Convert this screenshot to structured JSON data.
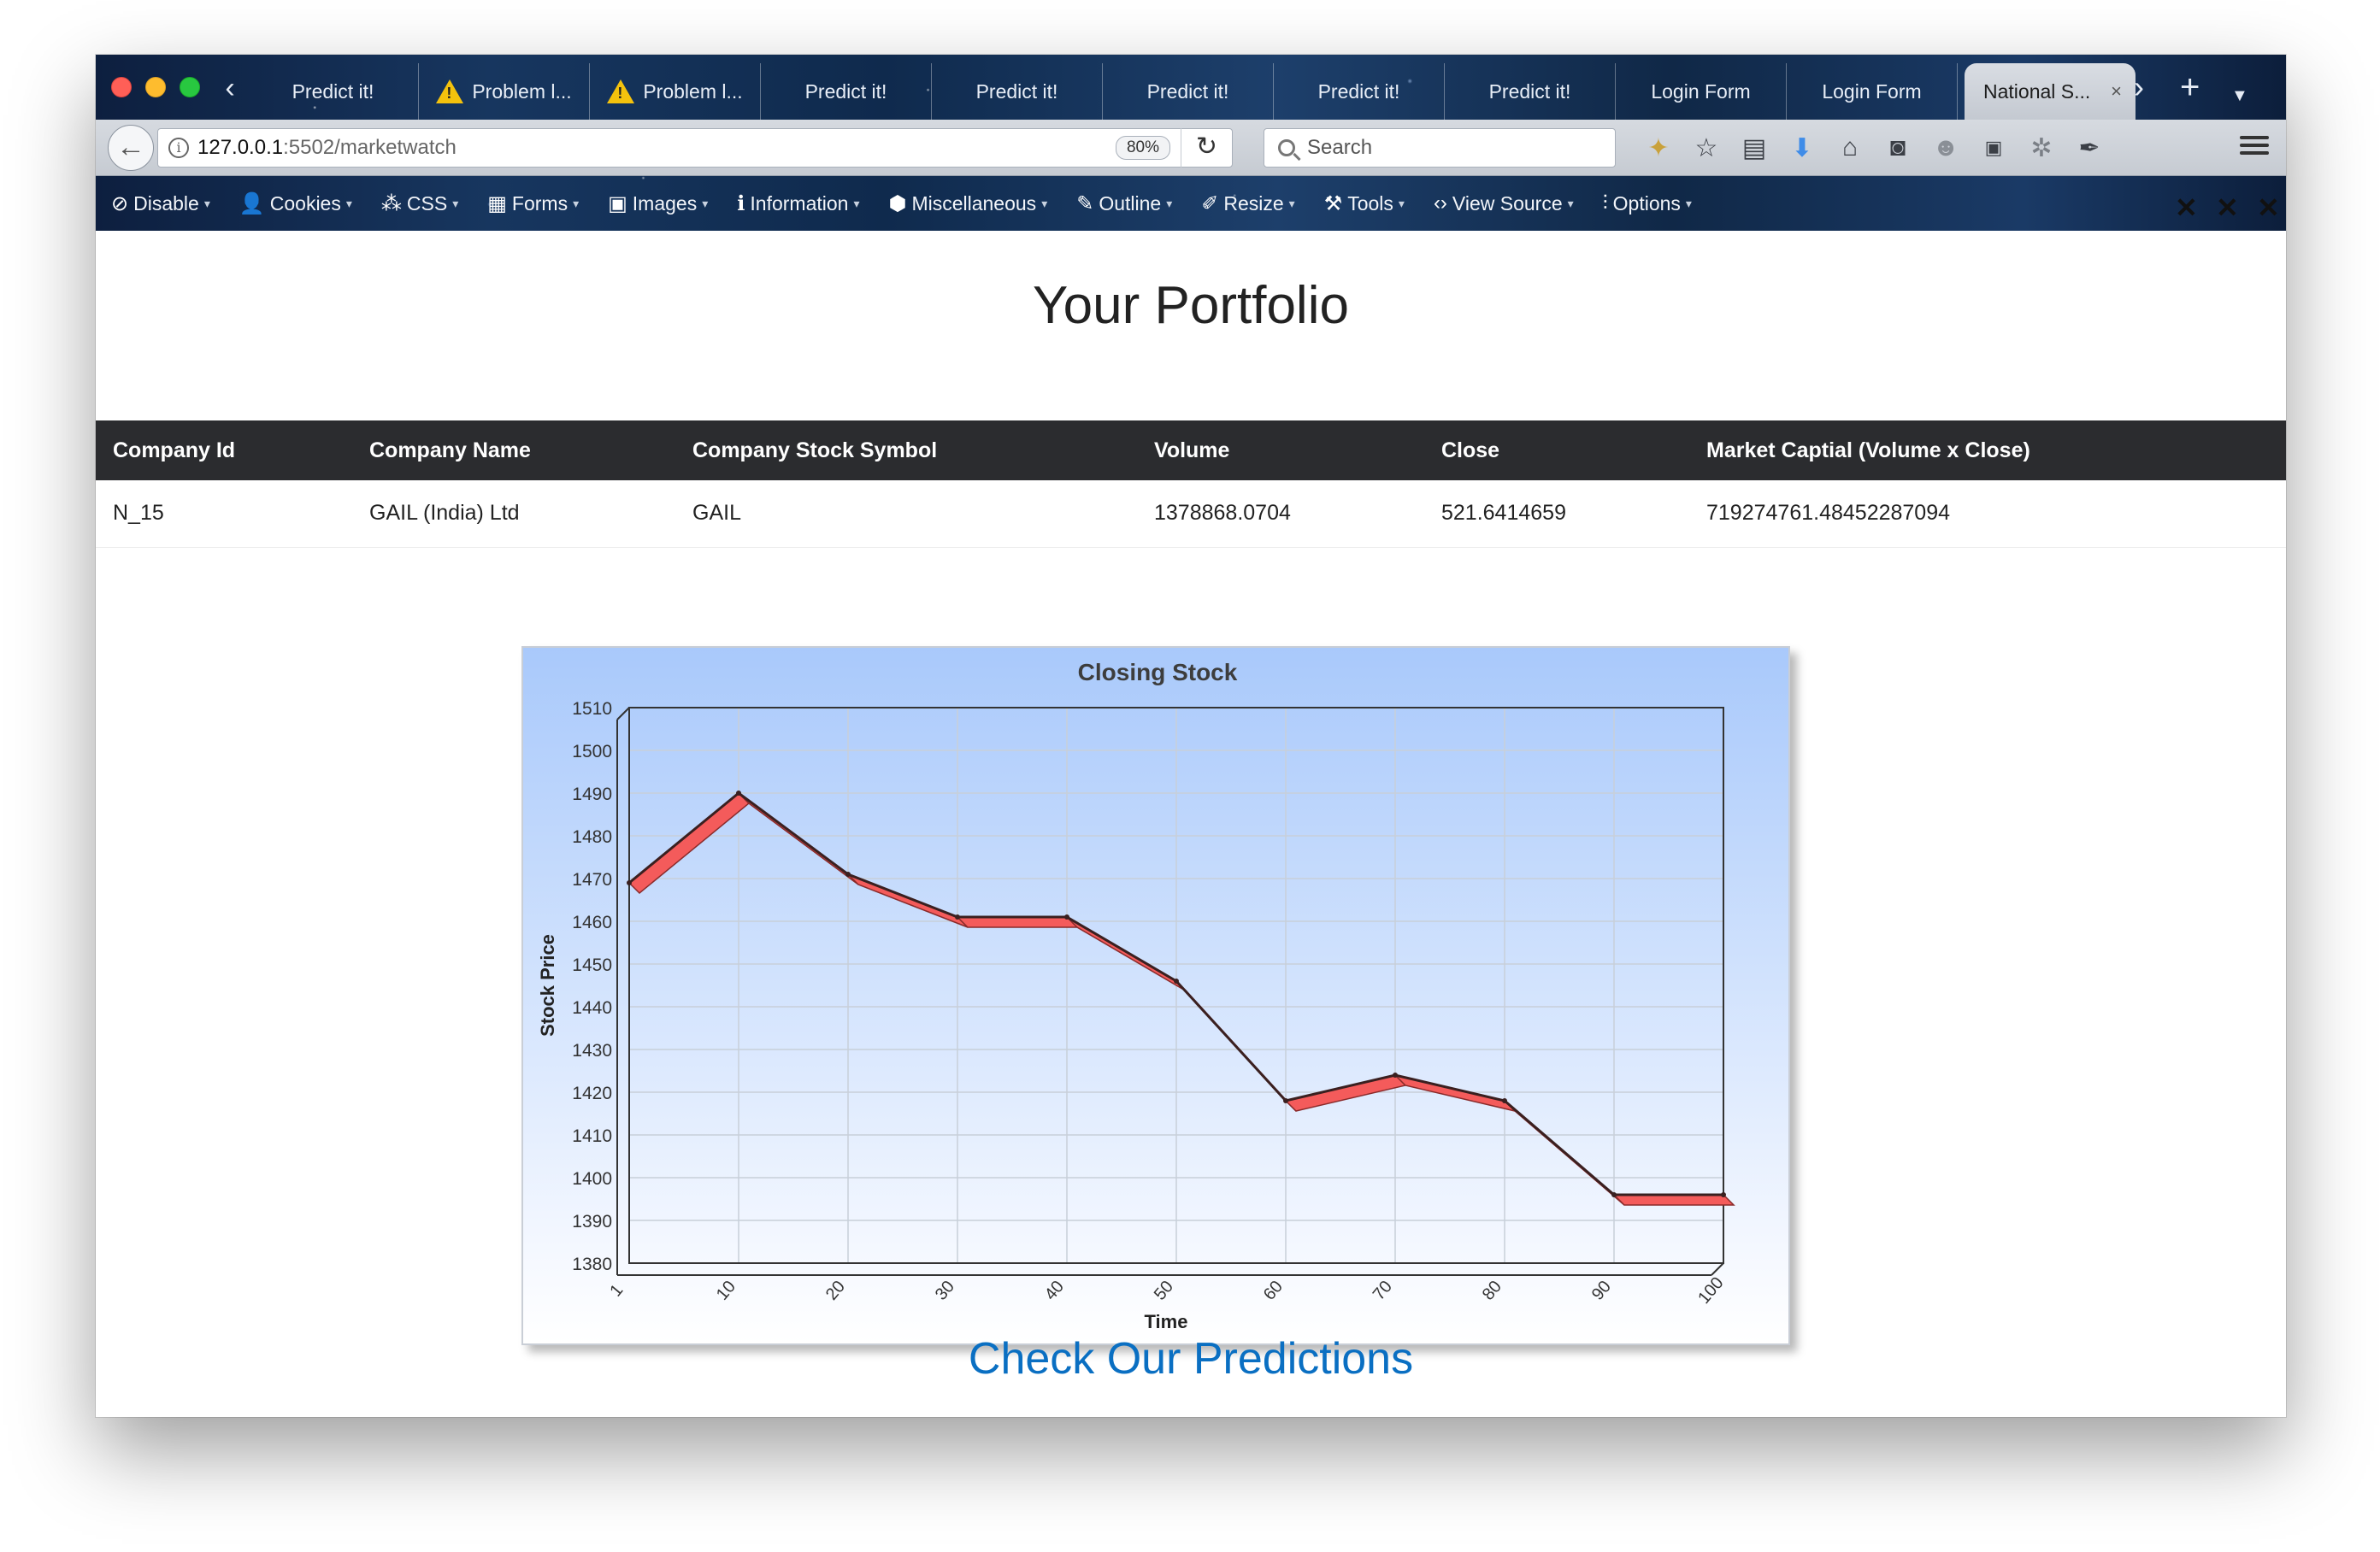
{
  "browser": {
    "tabs": [
      {
        "label": "Predict it!",
        "warning": false
      },
      {
        "label": "Problem l...",
        "warning": true
      },
      {
        "label": "Problem l...",
        "warning": true
      },
      {
        "label": "Predict it!",
        "warning": false
      },
      {
        "label": "Predict it!",
        "warning": false
      },
      {
        "label": "Predict it!",
        "warning": false
      },
      {
        "label": "Predict it!",
        "warning": false
      },
      {
        "label": "Predict it!",
        "warning": false
      },
      {
        "label": "Login Form",
        "warning": false
      },
      {
        "label": "Login Form",
        "warning": false
      }
    ],
    "active_tab": {
      "label": "National S...",
      "close": "×"
    },
    "new_tab": "+",
    "url_host": "127.0.0.1",
    "url_path": ":5502/marketwatch",
    "zoom": "80%",
    "search_placeholder": "Search"
  },
  "devbar": {
    "items": [
      {
        "label": "Disable",
        "icon": "⊘"
      },
      {
        "label": "Cookies",
        "icon": "👤"
      },
      {
        "label": "CSS",
        "icon": "⁂"
      },
      {
        "label": "Forms",
        "icon": "▦"
      },
      {
        "label": "Images",
        "icon": "▣"
      },
      {
        "label": "Information",
        "icon": "ℹ"
      },
      {
        "label": "Miscellaneous",
        "icon": "⬢"
      },
      {
        "label": "Outline",
        "icon": "✎"
      },
      {
        "label": "Resize",
        "icon": "✐"
      },
      {
        "label": "Tools",
        "icon": "⚒"
      },
      {
        "label": "View Source",
        "icon": "‹›"
      },
      {
        "label": "Options",
        "icon": "⫶"
      }
    ]
  },
  "page": {
    "title": "Your Portfolio",
    "table": {
      "headers": [
        "Company Id",
        "Company Name",
        "Company Stock Symbol",
        "Volume",
        "Close",
        "Market Captial (Volume x Close)"
      ],
      "rows": [
        [
          "N_15",
          "GAIL (India) Ltd",
          "GAIL",
          "1378868.0704",
          "521.6414659",
          "719274761.48452287094"
        ]
      ]
    },
    "link": "Check Our Predictions"
  },
  "chart_data": {
    "type": "line",
    "title": "Closing Stock",
    "xlabel": "Time",
    "ylabel": "Stock Price",
    "categories": [
      "1",
      "10",
      "20",
      "30",
      "40",
      "50",
      "60",
      "70",
      "80",
      "90",
      "100"
    ],
    "values": [
      1469,
      1490,
      1471,
      1461,
      1461,
      1446,
      1418,
      1424,
      1418,
      1396,
      1396
    ],
    "ylim": [
      1380,
      1510
    ],
    "yticks": [
      1510,
      1500,
      1490,
      1480,
      1470,
      1460,
      1450,
      1440,
      1430,
      1420,
      1410,
      1400,
      1390,
      1380
    ],
    "grid": true,
    "series_color": "#f45b5b",
    "background_top": "#a9c9fb",
    "background_bottom": "#ffffff"
  }
}
